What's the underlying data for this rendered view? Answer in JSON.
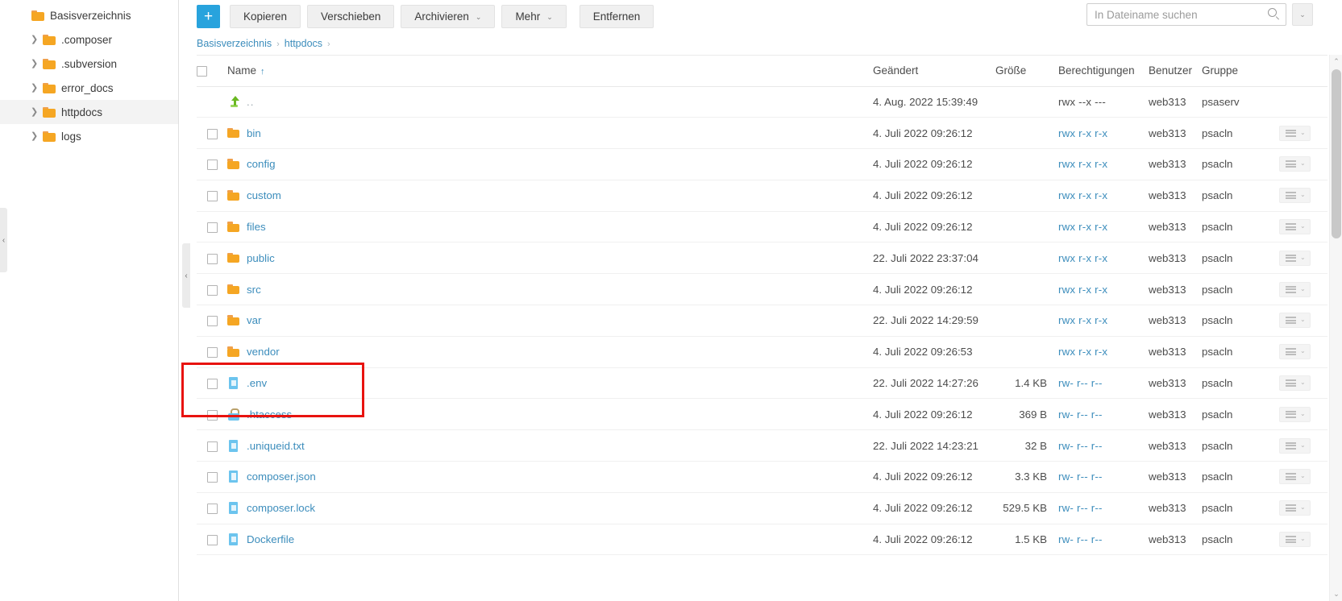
{
  "sidebar": {
    "items": [
      {
        "label": "Basisverzeichnis",
        "level": 0,
        "caret": false,
        "active": false
      },
      {
        "label": ".composer",
        "level": 1,
        "caret": true,
        "active": false
      },
      {
        "label": ".subversion",
        "level": 1,
        "caret": true,
        "active": false
      },
      {
        "label": "error_docs",
        "level": 1,
        "caret": true,
        "active": false
      },
      {
        "label": "httpdocs",
        "level": 1,
        "caret": true,
        "active": true
      },
      {
        "label": "logs",
        "level": 1,
        "caret": true,
        "active": false
      }
    ],
    "collapse_handle": "‹"
  },
  "toolbar": {
    "add_label": "+",
    "buttons": [
      {
        "label": "Kopieren",
        "caret": false
      },
      {
        "label": "Verschieben",
        "caret": false
      },
      {
        "label": "Archivieren",
        "caret": true
      },
      {
        "label": "Mehr",
        "caret": true
      }
    ],
    "remove_label": "Entfernen",
    "search_placeholder": "In Dateiname suchen",
    "search_value": "",
    "search_toggle_caret": "⌄"
  },
  "breadcrumb": {
    "items": [
      "Basisverzeichnis",
      "httpdocs"
    ],
    "separator": "›"
  },
  "table": {
    "headers": {
      "name": "Name",
      "sort_indicator": "↑",
      "modified": "Geändert",
      "size": "Größe",
      "permissions": "Berechtigungen",
      "user": "Benutzer",
      "group": "Gruppe"
    },
    "rows": [
      {
        "icon": "up-arrow-icon",
        "name": "..",
        "modified": "4. Aug. 2022 15:39:49",
        "size": "",
        "permissions": "rwx --x ---",
        "perm_link": false,
        "user": "web313",
        "group": "psaserv",
        "checkbox": false,
        "actions": false
      },
      {
        "icon": "folder-icon",
        "name": "bin",
        "modified": "4. Juli 2022 09:26:12",
        "size": "",
        "permissions": "rwx r-x r-x",
        "perm_link": true,
        "user": "web313",
        "group": "psacln",
        "checkbox": true,
        "actions": true
      },
      {
        "icon": "folder-icon",
        "name": "config",
        "modified": "4. Juli 2022 09:26:12",
        "size": "",
        "permissions": "rwx r-x r-x",
        "perm_link": true,
        "user": "web313",
        "group": "psacln",
        "checkbox": true,
        "actions": true
      },
      {
        "icon": "folder-icon",
        "name": "custom",
        "modified": "4. Juli 2022 09:26:12",
        "size": "",
        "permissions": "rwx r-x r-x",
        "perm_link": true,
        "user": "web313",
        "group": "psacln",
        "checkbox": true,
        "actions": true
      },
      {
        "icon": "folder-icon",
        "name": "files",
        "modified": "4. Juli 2022 09:26:12",
        "size": "",
        "permissions": "rwx r-x r-x",
        "perm_link": true,
        "user": "web313",
        "group": "psacln",
        "checkbox": true,
        "actions": true
      },
      {
        "icon": "folder-icon",
        "name": "public",
        "modified": "22. Juli 2022 23:37:04",
        "size": "",
        "permissions": "rwx r-x r-x",
        "perm_link": true,
        "user": "web313",
        "group": "psacln",
        "checkbox": true,
        "actions": true
      },
      {
        "icon": "folder-icon",
        "name": "src",
        "modified": "4. Juli 2022 09:26:12",
        "size": "",
        "permissions": "rwx r-x r-x",
        "perm_link": true,
        "user": "web313",
        "group": "psacln",
        "checkbox": true,
        "actions": true
      },
      {
        "icon": "folder-icon",
        "name": "var",
        "modified": "22. Juli 2022 14:29:59",
        "size": "",
        "permissions": "rwx r-x r-x",
        "perm_link": true,
        "user": "web313",
        "group": "psacln",
        "checkbox": true,
        "actions": true
      },
      {
        "icon": "folder-icon",
        "name": "vendor",
        "modified": "4. Juli 2022 09:26:53",
        "size": "",
        "permissions": "rwx r-x r-x",
        "perm_link": true,
        "user": "web313",
        "group": "psacln",
        "checkbox": true,
        "actions": true
      },
      {
        "icon": "file-icon",
        "name": ".env",
        "modified": "22. Juli 2022 14:27:26",
        "size": "1.4 KB",
        "permissions": "rw- r-- r--",
        "perm_link": true,
        "user": "web313",
        "group": "psacln",
        "checkbox": true,
        "actions": true
      },
      {
        "icon": "htaccess-icon",
        "name": ".htaccess",
        "modified": "4. Juli 2022 09:26:12",
        "size": "369 B",
        "permissions": "rw- r-- r--",
        "perm_link": true,
        "user": "web313",
        "group": "psacln",
        "checkbox": true,
        "actions": true
      },
      {
        "icon": "file-icon",
        "name": ".uniqueid.txt",
        "modified": "22. Juli 2022 14:23:21",
        "size": "32 B",
        "permissions": "rw- r-- r--",
        "perm_link": true,
        "user": "web313",
        "group": "psacln",
        "checkbox": true,
        "actions": true
      },
      {
        "icon": "json-file-icon",
        "name": "composer.json",
        "modified": "4. Juli 2022 09:26:12",
        "size": "3.3 KB",
        "permissions": "rw- r-- r--",
        "perm_link": true,
        "user": "web313",
        "group": "psacln",
        "checkbox": true,
        "actions": true
      },
      {
        "icon": "file-icon",
        "name": "composer.lock",
        "modified": "4. Juli 2022 09:26:12",
        "size": "529.5 KB",
        "permissions": "rw- r-- r--",
        "perm_link": true,
        "user": "web313",
        "group": "psacln",
        "checkbox": true,
        "actions": true
      },
      {
        "icon": "file-icon",
        "name": "Dockerfile",
        "modified": "4. Juli 2022 09:26:12",
        "size": "1.5 KB",
        "permissions": "rw- r-- r--",
        "perm_link": true,
        "user": "web313",
        "group": "psacln",
        "checkbox": true,
        "actions": true
      }
    ]
  },
  "scrollbar": {
    "up_arrow": "⌃",
    "down_arrow": "⌄"
  },
  "colors": {
    "accent": "#28a3dd",
    "link": "#3c8dbc",
    "folder": "#f5a623",
    "file": "#6cc4ee",
    "annotation": "#e8130f"
  }
}
